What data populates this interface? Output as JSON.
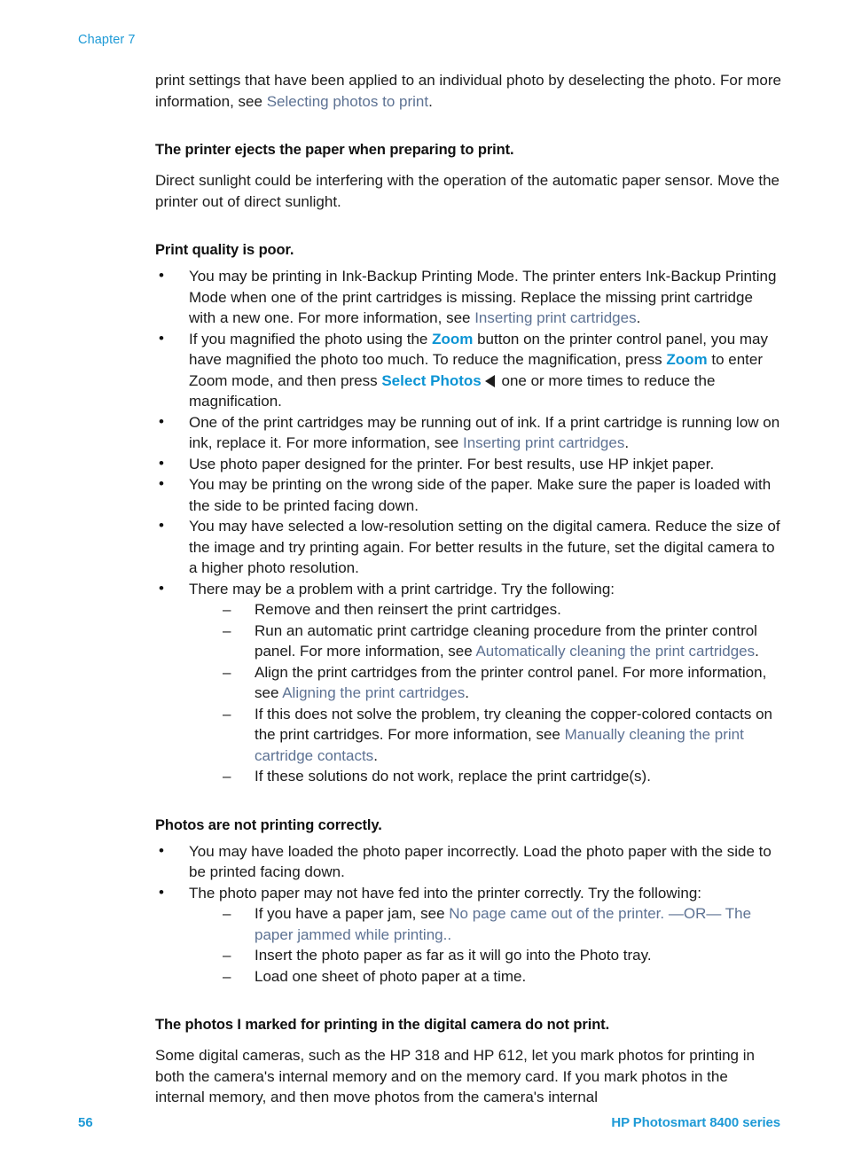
{
  "colors": {
    "accent_blue": "#1e9ad6",
    "ui_bold_blue": "#0b94d4",
    "xref_blue": "#5d7293",
    "body_text": "#1c1c1c",
    "page_background": "#ffffff"
  },
  "running_head": {
    "label": "Chapter 7"
  },
  "intro_paragraph": {
    "text_before_link": "print settings that have been applied to an individual photo by deselecting the photo. For more information, see ",
    "link": "Selecting photos to print",
    "text_after_link": "."
  },
  "sections": [
    {
      "heading": "The printer ejects the paper when preparing to print.",
      "paragraph": "Direct sunlight could be interfering with the operation of the automatic paper sensor. Move the printer out of direct sunlight."
    },
    {
      "heading": "Print quality is poor."
    },
    {
      "heading": "Photos are not printing correctly."
    },
    {
      "heading": "The photos I marked for printing in the digital camera do not print.",
      "paragraph": "Some digital cameras, such as the HP 318 and HP 612, let you mark photos for printing in both the camera's internal memory and on the memory card. If you mark photos in the internal memory, and then move photos from the camera's internal"
    }
  ],
  "print_quality_bullets": {
    "b1_before": "You may be printing in Ink-Backup Printing Mode. The printer enters Ink-Backup Printing Mode when one of the print cartridges is missing. Replace the missing print cartridge with a new one. For more information, see ",
    "b1_link": "Inserting print cartridges",
    "b1_after": ".",
    "b2_p1": "If you magnified the photo using the ",
    "b2_ui1": "Zoom",
    "b2_p2": " button on the printer control panel, you may have magnified the photo too much. To reduce the magnification, press ",
    "b2_ui2": "Zoom",
    "b2_p3": " to enter Zoom mode, and then press ",
    "b2_ui3": "Select Photos",
    "b2_icon": "left-triangle-icon",
    "b2_p4": " one or more times to reduce the magnification.",
    "b3_before": "One of the print cartridges may be running out of ink. If a print cartridge is running low on ink, replace it. For more information, see ",
    "b3_link": "Inserting print cartridges",
    "b3_after": ".",
    "b4": "Use photo paper designed for the printer. For best results, use HP inkjet paper.",
    "b5": "You may be printing on the wrong side of the paper. Make sure the paper is loaded with the side to be printed facing down.",
    "b6": "You may have selected a low-resolution setting on the digital camera. Reduce the size of the image and try printing again. For better results in the future, set the digital camera to a higher photo resolution.",
    "b7": "There may be a problem with a print cartridge. Try the following:",
    "b7_sub1": "Remove and then reinsert the print cartridges.",
    "b7_sub2_before": "Run an automatic print cartridge cleaning procedure from the printer control panel. For more information, see ",
    "b7_sub2_link": "Automatically cleaning the print cartridges",
    "b7_sub2_after": ".",
    "b7_sub3_before": "Align the print cartridges from the printer control panel. For more information, see ",
    "b7_sub3_link": "Aligning the print cartridges",
    "b7_sub3_after": ".",
    "b7_sub4_before": "If this does not solve the problem, try cleaning the copper-colored contacts on the print cartridges. For more information, see ",
    "b7_sub4_link": "Manually cleaning the print cartridge contacts",
    "b7_sub4_after": ".",
    "b7_sub5": "If these solutions do not work, replace the print cartridge(s)."
  },
  "photos_bullets": {
    "b1": "You may have loaded the photo paper incorrectly. Load the photo paper with the side to be printed facing down.",
    "b2": "The photo paper may not have fed into the printer correctly. Try the following:",
    "b2_sub1_before": "If you have a paper jam, see ",
    "b2_sub1_link": "No page came out of the printer. —OR— The paper jammed while printing.",
    "b2_sub1_after": ".",
    "b2_sub2": "Insert the photo paper as far as it will go into the Photo tray.",
    "b2_sub3": "Load one sheet of photo paper at a time."
  },
  "footer": {
    "page_number": "56",
    "product_name": "HP Photosmart 8400 series"
  }
}
